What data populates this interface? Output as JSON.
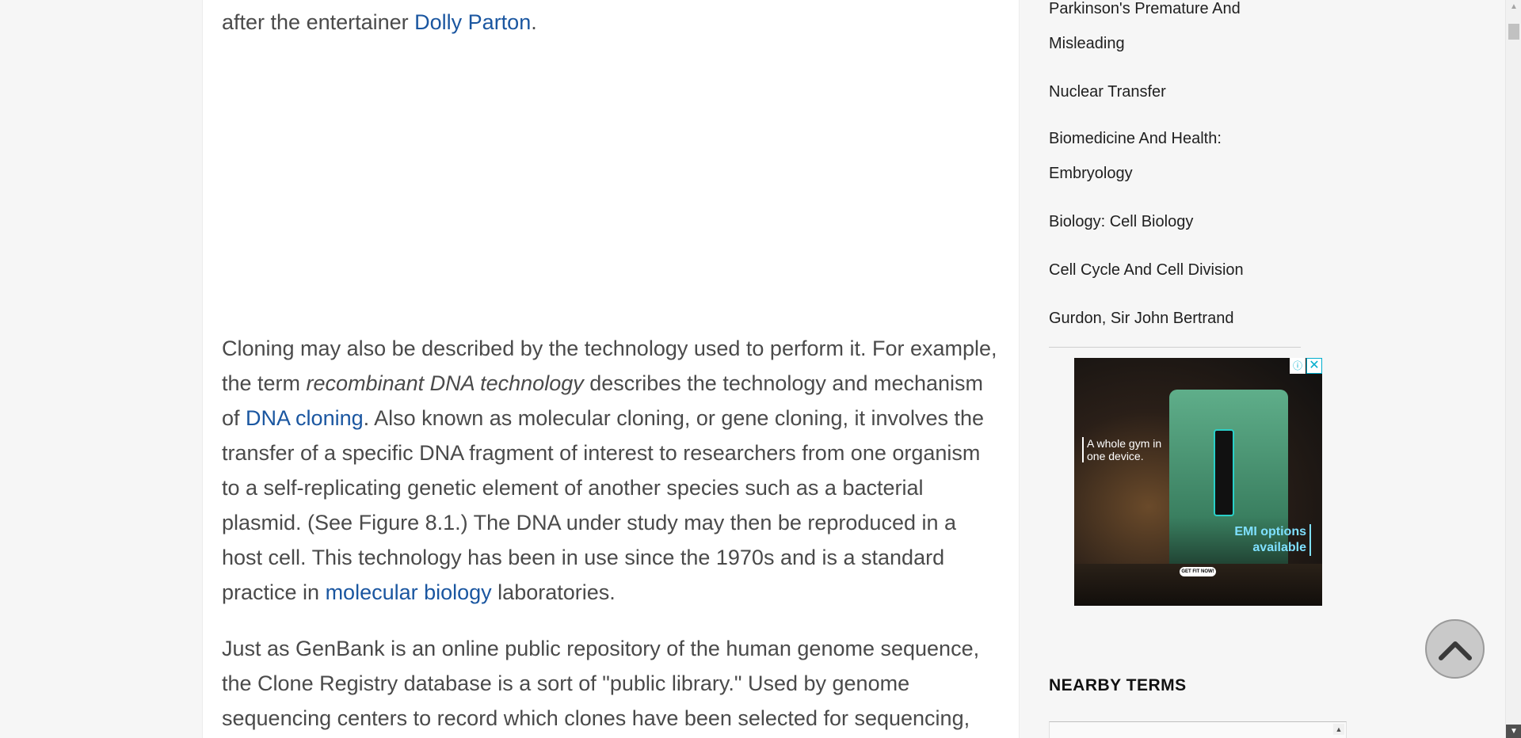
{
  "article": {
    "top_fragment_pre": "after the entertainer ",
    "top_fragment_link": "Dolly Parton",
    "top_fragment_post": ".",
    "p1": {
      "t1": "Cloning may also be described by the technology used to perform it. For example, the term ",
      "em": "recombinant DNA technology",
      "t2": " describes the technology and mechanism of ",
      "link1": "DNA cloning",
      "t3": ". Also known as molecular cloning, or gene cloning, it involves the transfer of a specific DNA fragment of interest to researchers from one organism to a self-replicating genetic element of another species such as a bacterial plasmid. (See Figure 8.1.) The DNA under study may then be reproduced in a host cell. This technology has been in use since the 1970s and is a standard practice in ",
      "link2": "molecular biology",
      "t4": " laboratories."
    },
    "p2": "Just as GenBank is an online public repository of the human genome sequence, the Clone Registry database is a sort of \"public library.\" Used by genome sequencing centers to record which clones have been selected for sequencing,"
  },
  "sidebar": {
    "related_links": [
      "Parkinson's Premature And Misleading",
      "Nuclear Transfer",
      "Biomedicine And Health: Embryology",
      "Biology: Cell Biology",
      "Cell Cycle And Cell Division",
      "Gurdon, Sir John Bertrand"
    ],
    "ad": {
      "text1": "A whole gym in one device.",
      "text2": "EMI options available",
      "cta": "GET FIT NOW!",
      "info_label": "ⓘ",
      "close_label": "✕"
    },
    "nearby_heading": "NEARBY TERMS"
  },
  "colors": {
    "link": "#1a56a0",
    "body_text": "#4a4a4a",
    "page_bg": "#f6f6f6"
  },
  "icons": {
    "back_to_top": "chevron-up-icon",
    "scroll_up": "scroll-up-arrow-icon",
    "scroll_down": "scroll-down-arrow-icon"
  }
}
